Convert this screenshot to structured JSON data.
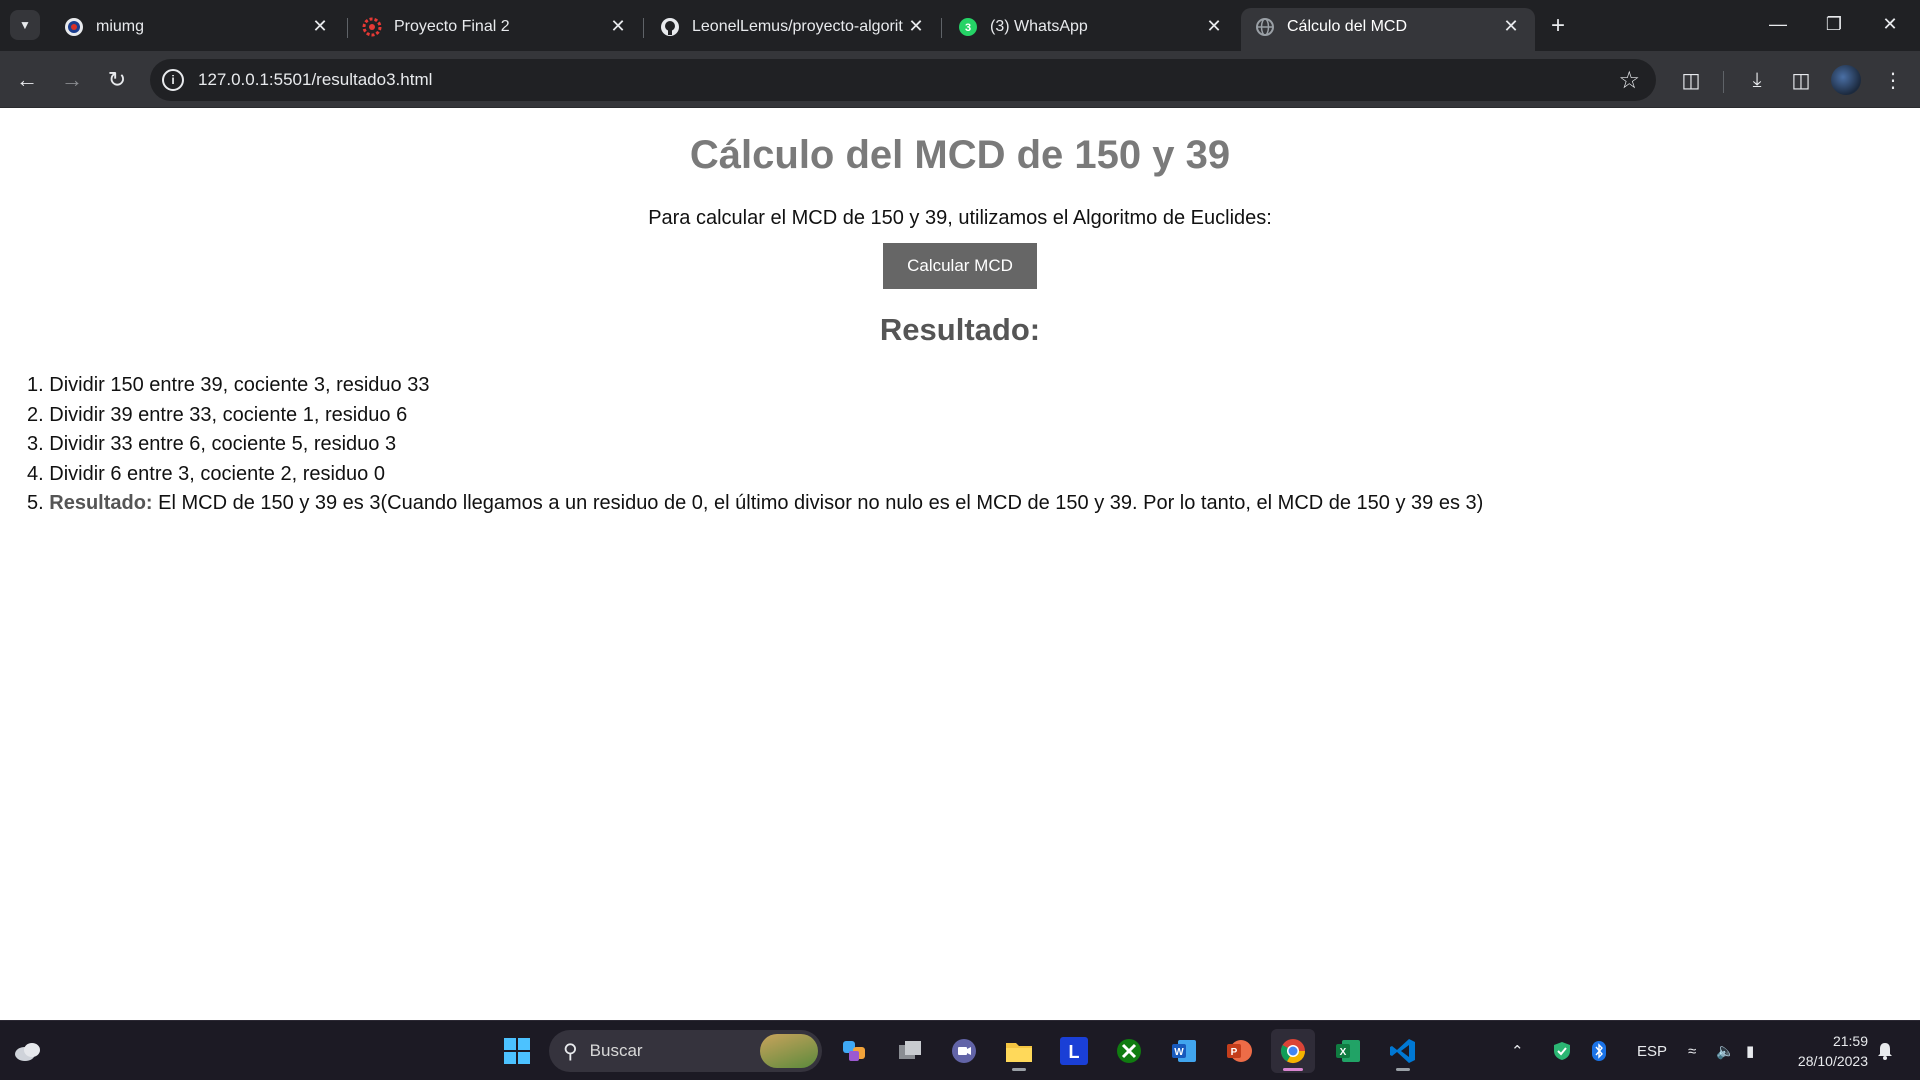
{
  "browser": {
    "tabs": [
      {
        "title": "miumg",
        "favicon": "umg-icon",
        "active": false
      },
      {
        "title": "Proyecto Final 2",
        "favicon": "project-icon",
        "active": false
      },
      {
        "title": "LeonelLemus/proyecto-algorit",
        "favicon": "github-icon",
        "active": false
      },
      {
        "title": "(3) WhatsApp",
        "favicon": "whatsapp-icon",
        "active": false
      },
      {
        "title": "Cálculo del MCD",
        "favicon": "globe-icon",
        "active": true
      }
    ],
    "url": "127.0.0.1:5501/resultado3.html"
  },
  "page": {
    "title": "Cálculo del MCD de 150 y 39",
    "intro": "Para calcular el MCD de 150 y 39, utilizamos el Algoritmo de Euclides:",
    "button_label": "Calcular MCD",
    "result_heading": "Resultado:",
    "steps": [
      {
        "num": "1.",
        "text": "Dividir 150 entre 39, cociente 3, residuo 33"
      },
      {
        "num": "2.",
        "text": "Dividir 39 entre 33, cociente 1, residuo 6"
      },
      {
        "num": "3.",
        "text": "Dividir 33 entre 6, cociente 5, residuo 3"
      },
      {
        "num": "4.",
        "text": "Dividir 6 entre 3, cociente 2, residuo 0"
      }
    ],
    "final_step": {
      "num": "5.",
      "label": "Resultado:",
      "text": " El MCD de 150 y 39 es 3(Cuando llegamos a un residuo de 0, el último divisor no nulo es el MCD de 150 y 39. Por lo tanto, el MCD de 150 y 39 es 3)"
    }
  },
  "taskbar": {
    "search_placeholder": "Buscar",
    "language": "ESP",
    "time": "21:59",
    "date": "28/10/2023"
  },
  "colors": {
    "title_gray": "#7a7a7a",
    "button_bg": "#666666",
    "chrome_dark": "#202124",
    "chrome_toolbar": "#35363a"
  }
}
